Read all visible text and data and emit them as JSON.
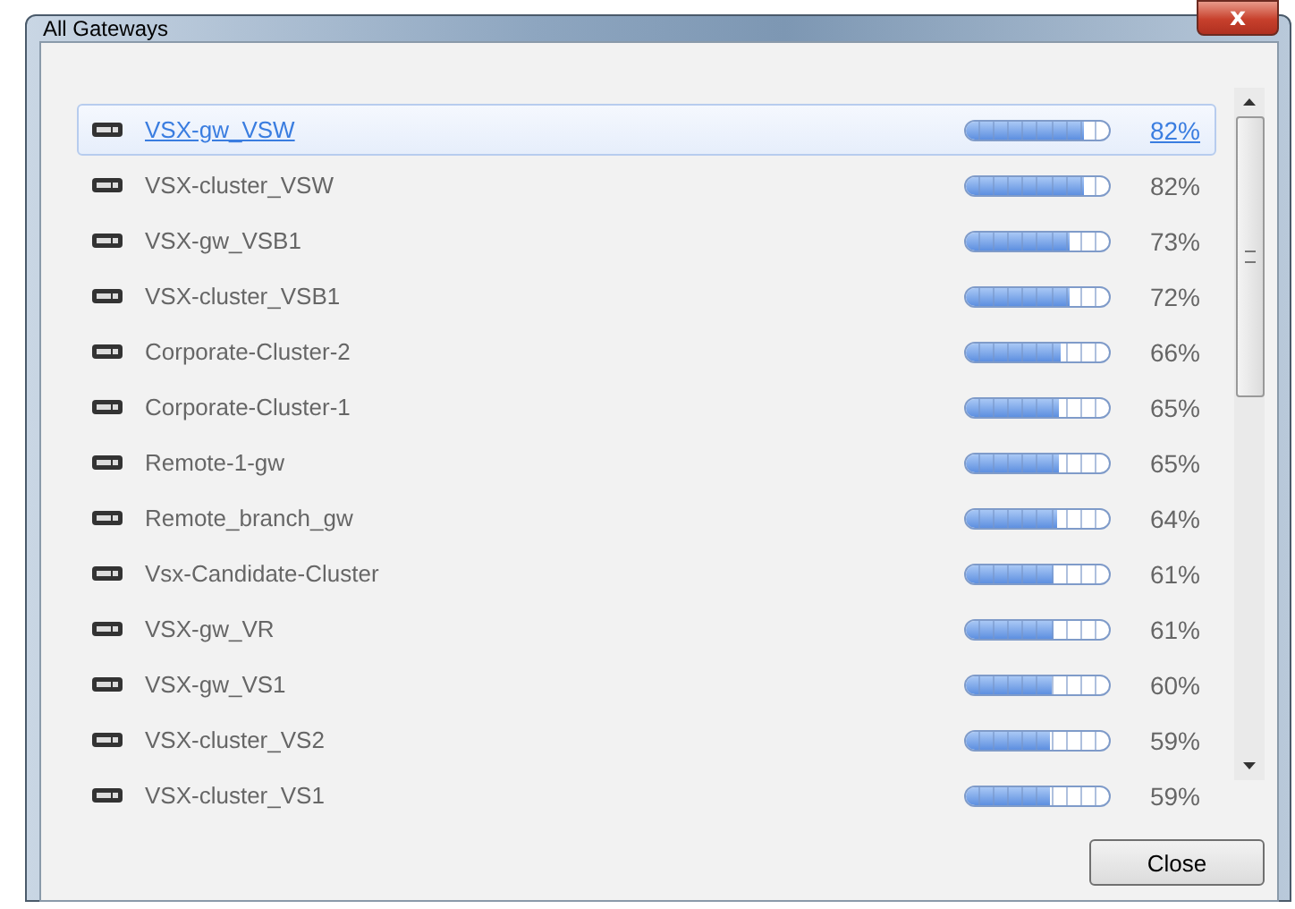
{
  "window": {
    "title": "All Gateways",
    "close_glyph": "x"
  },
  "gateways": [
    {
      "name": "VSX-gw_VSW",
      "level": 0.82,
      "reading": "82%",
      "selected": true
    },
    {
      "name": "VSX-cluster_VSW",
      "level": 0.82,
      "reading": "82%",
      "selected": false
    },
    {
      "name": "VSX-gw_VSB1",
      "level": 0.73,
      "reading": "73%",
      "selected": false
    },
    {
      "name": "VSX-cluster_VSB1",
      "level": 0.72,
      "reading": "72%",
      "selected": false
    },
    {
      "name": "Corporate-Cluster-2",
      "level": 0.66,
      "reading": "66%",
      "selected": false
    },
    {
      "name": "Corporate-Cluster-1",
      "level": 0.65,
      "reading": "65%",
      "selected": false
    },
    {
      "name": "Remote-1-gw",
      "level": 0.65,
      "reading": "65%",
      "selected": false
    },
    {
      "name": "Remote_branch_gw",
      "level": 0.64,
      "reading": "64%",
      "selected": false
    },
    {
      "name": "Vsx-Candidate-Cluster",
      "level": 0.61,
      "reading": "61%",
      "selected": false
    },
    {
      "name": "VSX-gw_VR",
      "level": 0.61,
      "reading": "61%",
      "selected": false
    },
    {
      "name": "VSX-gw_VS1",
      "level": 0.6,
      "reading": "60%",
      "selected": false
    },
    {
      "name": "VSX-cluster_VS2",
      "level": 0.59,
      "reading": "59%",
      "selected": false
    },
    {
      "name": "VSX-cluster_VS1",
      "level": 0.59,
      "reading": "59%",
      "selected": false
    }
  ],
  "buttons": [
    "Close"
  ]
}
